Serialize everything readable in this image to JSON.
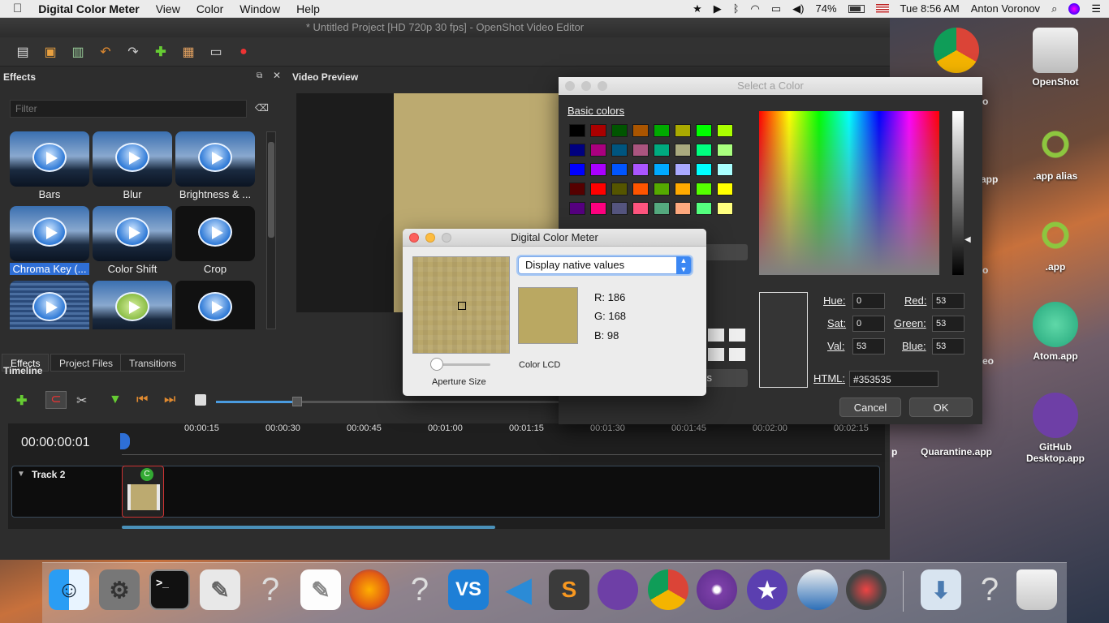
{
  "menubar": {
    "apple": "",
    "app_name": "Digital Color Meter",
    "menus": [
      "View",
      "Color",
      "Window",
      "Help"
    ],
    "battery": "74%",
    "clock": "Tue 8:56 AM",
    "user": "Anton Voronov"
  },
  "openshot": {
    "title": "* Untitled Project [HD 720p 30 fps] - OpenShot Video Editor",
    "effects_title": "Effects",
    "filter_placeholder": "Filter",
    "video_preview_title": "Video Preview",
    "effects": [
      {
        "label": "Bars"
      },
      {
        "label": "Blur"
      },
      {
        "label": "Brightness & ..."
      },
      {
        "label": "Chroma Key (..."
      },
      {
        "label": "Color Shift"
      },
      {
        "label": "Crop"
      }
    ],
    "tabs": [
      "Effects",
      "Project Files",
      "Transitions"
    ],
    "timeline_title": "Timeline",
    "timecode": "00:00:00:01",
    "ruler": [
      "00:00:15",
      "00:00:30",
      "00:00:45",
      "00:01:00",
      "00:01:15",
      "00:01:30",
      "00:01:45",
      "00:02:00",
      "00:02:15"
    ],
    "track_name": "Track 2",
    "clip_badge": "C"
  },
  "color_dialog": {
    "title": "Select a Color",
    "basic_colors_label": "Basic colors",
    "basic_colors": [
      "#000000",
      "#aa0000",
      "#005500",
      "#aa5500",
      "#00aa00",
      "#aaaa00",
      "#00ff00",
      "#aaff00",
      "#00007f",
      "#aa007f",
      "#00557f",
      "#aa557f",
      "#00aa7f",
      "#aaaa7f",
      "#00ff7f",
      "#aaff7f",
      "#0000ff",
      "#aa00ff",
      "#0055ff",
      "#aa55ff",
      "#00aaff",
      "#aaaaff",
      "#00ffff",
      "#aaffff",
      "#550000",
      "#ff0000",
      "#555500",
      "#ff5500",
      "#55aa00",
      "#ffaa00",
      "#55ff00",
      "#ffff00",
      "#55007f",
      "#ff007f",
      "#55557f",
      "#ff557f",
      "#55aa7f",
      "#ffaa7f",
      "#55ff7f",
      "#ffff7f"
    ],
    "hue_label": "Hue:",
    "hue": "0",
    "sat_label": "Sat:",
    "sat": "0",
    "val_label": "Val:",
    "val": "53",
    "red_label": "Red:",
    "red": "53",
    "green_label": "Green:",
    "green": "53",
    "blue_label": "Blue:",
    "blue": "53",
    "html_label": "HTML:",
    "html": "#353535",
    "cancel": "Cancel",
    "ok": "OK",
    "partial_s": "s"
  },
  "dcm": {
    "title": "Digital Color Meter",
    "mode": "Display native values",
    "r": "R: 186",
    "g": "G: 168",
    "b": "B: 98",
    "sample_color": "#baa862",
    "aperture_label": "Aperture Size",
    "profile": "Color LCD"
  },
  "desktop": [
    {
      "label": "OpenShot"
    },
    {
      "label": ".app alias"
    },
    {
      "label": ".app"
    },
    {
      "label": "Atom.app"
    },
    {
      "label": "Quarantine.app"
    },
    {
      "label": "GitHub Desktop.app"
    }
  ],
  "desktop_partial": {
    "p1": "o",
    "p2": "app",
    "p3": "o",
    "p4": "eo",
    "p5": "p"
  },
  "dock": [
    "Finder",
    "System Preferences",
    "Terminal",
    "Script Editor",
    "?",
    "TextEdit",
    "Firefox",
    "?",
    "VS",
    "VS Code",
    "Sublime Text",
    "GitHub Desktop",
    "Chrome",
    "Tor",
    "iMovie",
    "OpenShot",
    "Digital Color Meter",
    "Downloads",
    "?",
    "Trash"
  ]
}
